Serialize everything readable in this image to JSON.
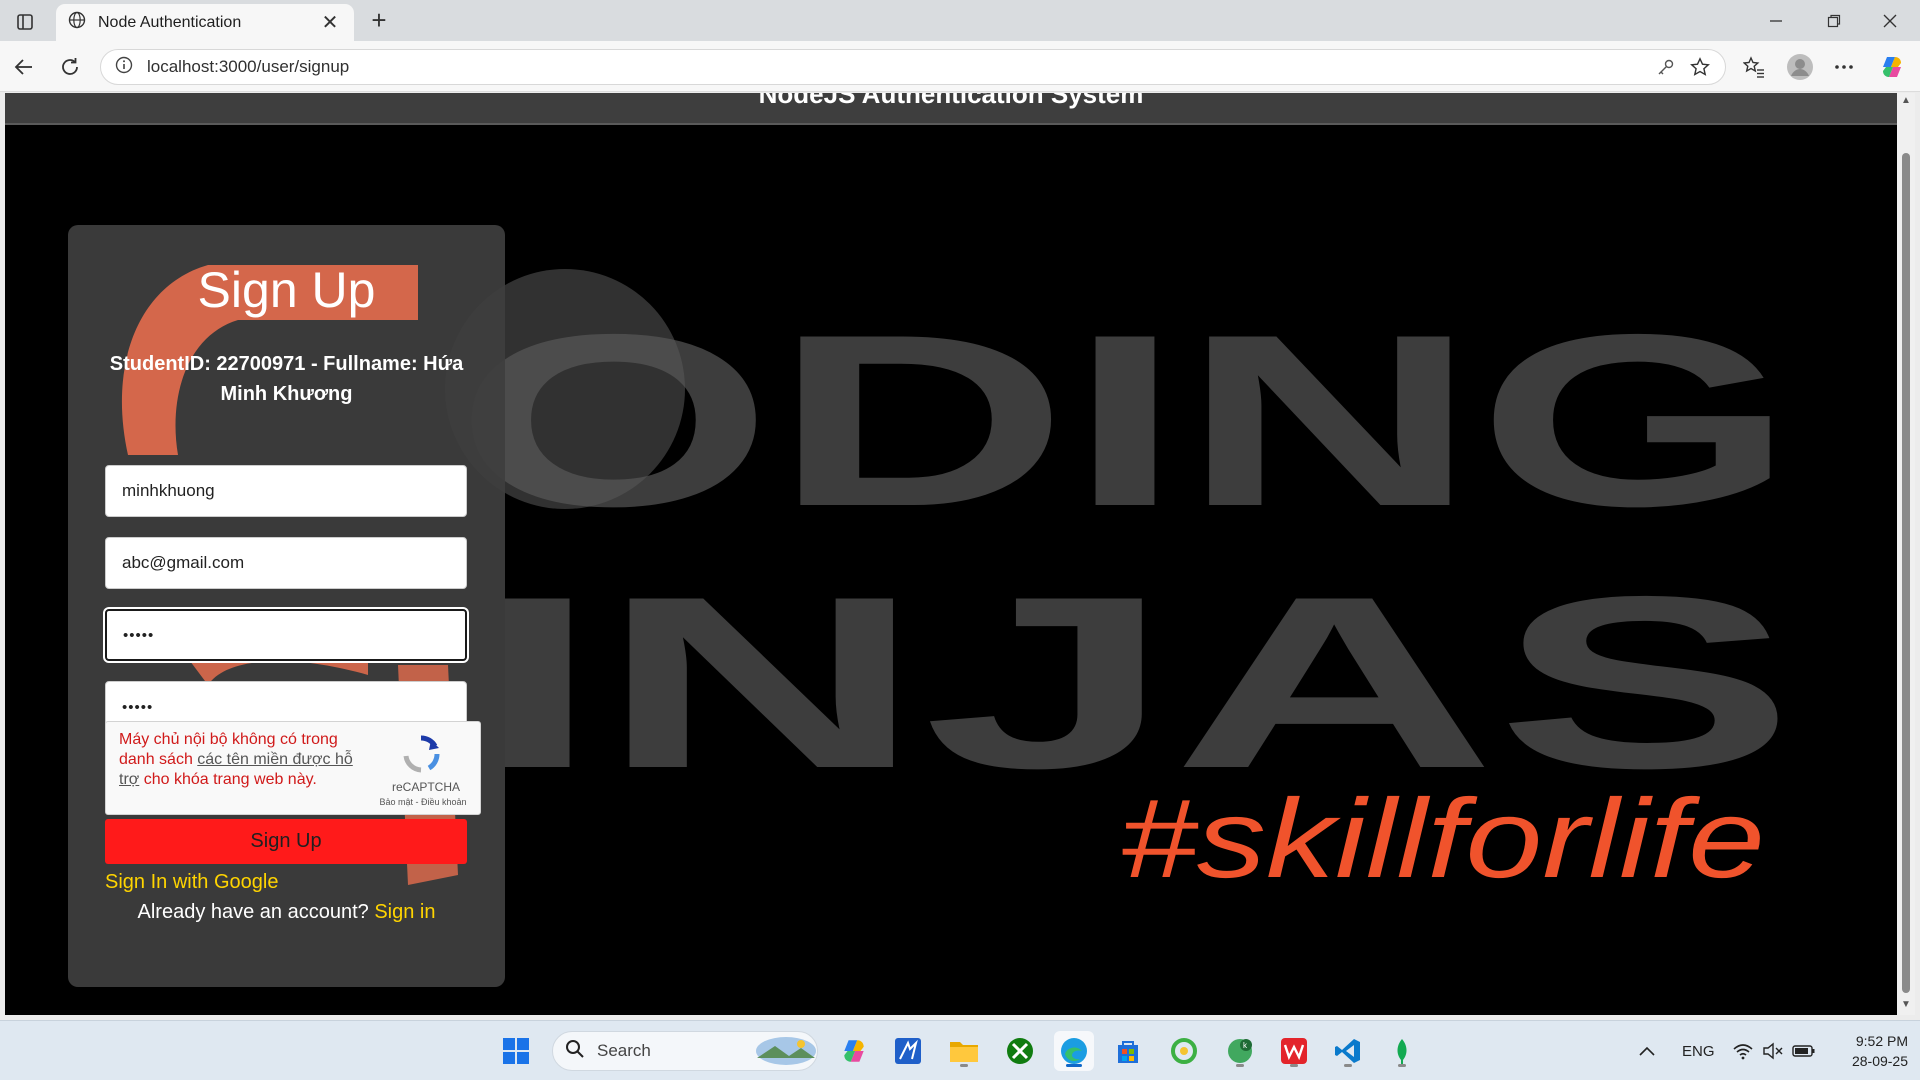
{
  "browser": {
    "tab_title": "Node Authentication",
    "tab_close": "✕",
    "new_tab": "+",
    "url": "localhost:3000/user/signup"
  },
  "page": {
    "header_title": "NodeJS Authentication System",
    "hero": {
      "word1": "ODING",
      "word2": "INJAS",
      "tagline": "#skillforlife"
    }
  },
  "signup": {
    "heading": "Sign Up",
    "student_info": "StudentID: 22700971 - Fullname: Hứa Minh Khương",
    "name_value": "minhkhuong",
    "email_value": "abc@gmail.com",
    "password_mask": "•••••",
    "confirm_mask": "•••••",
    "captcha": {
      "msg_part1": "Máy chủ nội bộ không có trong danh sách ",
      "msg_link": "các tên miền được hỗ trợ",
      "msg_part2": " cho khóa trang web này.",
      "brand": "reCAPTCHA",
      "terms": "Bảo mật - Điều khoản"
    },
    "submit_label": "Sign Up",
    "google_label": "Sign In with Google",
    "have_account": "Already have an account?",
    "signin_label": "Sign in"
  },
  "taskbar": {
    "search_label": "Search",
    "language": "ENG",
    "time": "9:52 PM",
    "date": "28-09-25"
  },
  "colors": {
    "accent_red": "#ff1a1a",
    "link_yellow": "#ffd400",
    "hero_orange": "#f0532c",
    "hero_gray": "#3d3d3d"
  }
}
